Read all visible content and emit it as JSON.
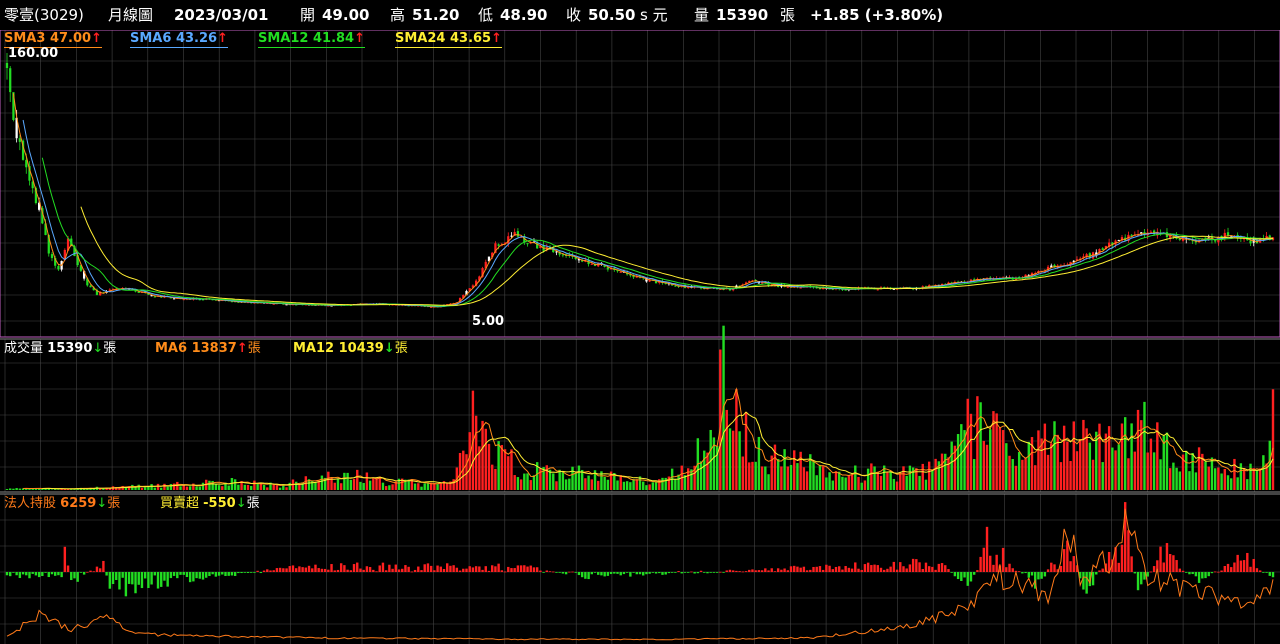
{
  "header": {
    "stock": "零壹(3029)",
    "period": "月線圖",
    "date": "2023/03/01",
    "open_label": "開",
    "open": "49.00",
    "high_label": "高",
    "high": "51.20",
    "low_label": "低",
    "low": "48.90",
    "close_label": "收",
    "close": "50.50",
    "close_suffix": "s 元",
    "volume_label": "量",
    "volume": "15390",
    "unit": "張",
    "change": "+1.85 (+3.80%)"
  },
  "price_legend": [
    {
      "label": "SMA3",
      "value": "47.00",
      "color": "#ff8c1a",
      "arrow": "up"
    },
    {
      "label": "SMA6",
      "value": "43.26",
      "color": "#5aa9ff",
      "arrow": "up"
    },
    {
      "label": "SMA12",
      "value": "41.84",
      "color": "#22dd22",
      "arrow": "up"
    },
    {
      "label": "SMA24",
      "value": "43.65",
      "color": "#ffee33",
      "arrow": "up"
    }
  ],
  "price_axis": {
    "max_label": "160.00",
    "min_label": "5.00"
  },
  "volume_legend": {
    "label": "成交量",
    "value": "15390",
    "arrow": "down",
    "unit": "張",
    "ma6_label": "MA6",
    "ma6_value": "13837",
    "ma6_arrow": "up",
    "ma12_label": "MA12",
    "ma12_value": "10439",
    "ma12_arrow": "down"
  },
  "inst_legend": {
    "label": "法人持股",
    "value": "6259",
    "arrow": "down",
    "unit": "張",
    "net_label": "買賣超",
    "net_value": "-550",
    "net_arrow": "down"
  },
  "colors": {
    "up": "#ff2020",
    "down": "#22dd22",
    "even": "#ffffff",
    "grid": "#444444",
    "sma3": "#ff8c1a",
    "sma6": "#5aa9ff",
    "sma12": "#22dd22",
    "sma24": "#ffee33",
    "holding": "#ff7a1a"
  },
  "chart_data": {
    "type": "candlestick",
    "title": "零壹(3029) 月線圖",
    "price_range": [
      5.0,
      160.0
    ],
    "last_bar": {
      "date": "2023/03/01",
      "open": 49.0,
      "high": 51.2,
      "low": 48.9,
      "close": 50.5,
      "volume": 15390
    },
    "price_anchors": [
      [
        0,
        160
      ],
      [
        2,
        120
      ],
      [
        5,
        100
      ],
      [
        8,
        80
      ],
      [
        11,
        60
      ],
      [
        13,
        40
      ],
      [
        16,
        30
      ],
      [
        19,
        50
      ],
      [
        22,
        35
      ],
      [
        25,
        22
      ],
      [
        28,
        16
      ],
      [
        32,
        18
      ],
      [
        36,
        20
      ],
      [
        45,
        15
      ],
      [
        55,
        13
      ],
      [
        62,
        13
      ],
      [
        72,
        11
      ],
      [
        85,
        10
      ],
      [
        100,
        9
      ],
      [
        115,
        10
      ],
      [
        125,
        9
      ],
      [
        134,
        8
      ],
      [
        140,
        11
      ],
      [
        146,
        24
      ],
      [
        152,
        46
      ],
      [
        158,
        52
      ],
      [
        166,
        44
      ],
      [
        174,
        40
      ],
      [
        182,
        35
      ],
      [
        190,
        30
      ],
      [
        200,
        24
      ],
      [
        212,
        20
      ],
      [
        225,
        19
      ],
      [
        232,
        24
      ],
      [
        240,
        21
      ],
      [
        260,
        19
      ],
      [
        285,
        20
      ],
      [
        300,
        24
      ],
      [
        315,
        26
      ],
      [
        328,
        34
      ],
      [
        338,
        40
      ],
      [
        345,
        48
      ],
      [
        352,
        54
      ],
      [
        360,
        52
      ],
      [
        372,
        48
      ],
      [
        380,
        52
      ],
      [
        388,
        48
      ],
      [
        394,
        50.5
      ]
    ],
    "volume_peaks": [
      [
        0,
        300
      ],
      [
        20,
        200
      ],
      [
        45,
        800
      ],
      [
        70,
        1500
      ],
      [
        85,
        1000
      ],
      [
        105,
        3000
      ],
      [
        115,
        1800
      ],
      [
        138,
        1200
      ],
      [
        143,
        8000
      ],
      [
        146,
        22000
      ],
      [
        148,
        14000
      ],
      [
        150,
        9000
      ],
      [
        155,
        6000
      ],
      [
        160,
        4000
      ],
      [
        175,
        3500
      ],
      [
        190,
        2500
      ],
      [
        205,
        1500
      ],
      [
        218,
        9000
      ],
      [
        222,
        22000
      ],
      [
        226,
        17000
      ],
      [
        232,
        7000
      ],
      [
        246,
        5000
      ],
      [
        262,
        3000
      ],
      [
        290,
        4000
      ],
      [
        300,
        13000
      ],
      [
        318,
        6000
      ],
      [
        328,
        11000
      ],
      [
        332,
        9000
      ],
      [
        345,
        8000
      ],
      [
        350,
        13000
      ],
      [
        365,
        6000
      ],
      [
        375,
        5000
      ],
      [
        390,
        3000
      ],
      [
        394,
        15390
      ]
    ],
    "net_peaks": [
      [
        18,
        2500
      ],
      [
        20,
        -1500
      ],
      [
        30,
        1200
      ],
      [
        32,
        -2200
      ],
      [
        40,
        -2000
      ],
      [
        90,
        800
      ],
      [
        160,
        700
      ],
      [
        180,
        -600
      ],
      [
        290,
        1200
      ],
      [
        300,
        -1800
      ],
      [
        305,
        4500
      ],
      [
        320,
        -2000
      ],
      [
        330,
        3500
      ],
      [
        336,
        -2500
      ],
      [
        345,
        3600
      ],
      [
        348,
        6500
      ],
      [
        352,
        -2600
      ],
      [
        360,
        3000
      ],
      [
        370,
        -1500
      ],
      [
        385,
        2000
      ],
      [
        394,
        -550
      ]
    ],
    "holding_anchors": [
      [
        0,
        500
      ],
      [
        10,
        2800
      ],
      [
        20,
        1200
      ],
      [
        30,
        2500
      ],
      [
        40,
        800
      ],
      [
        60,
        600
      ],
      [
        100,
        400
      ],
      [
        150,
        300
      ],
      [
        200,
        250
      ],
      [
        250,
        400
      ],
      [
        280,
        1500
      ],
      [
        300,
        3500
      ],
      [
        305,
        7000
      ],
      [
        315,
        5800
      ],
      [
        325,
        4500
      ],
      [
        330,
        11000
      ],
      [
        335,
        6000
      ],
      [
        345,
        9000
      ],
      [
        348,
        14000
      ],
      [
        355,
        6500
      ],
      [
        365,
        5500
      ],
      [
        375,
        4800
      ],
      [
        385,
        3800
      ],
      [
        394,
        6259
      ]
    ]
  }
}
